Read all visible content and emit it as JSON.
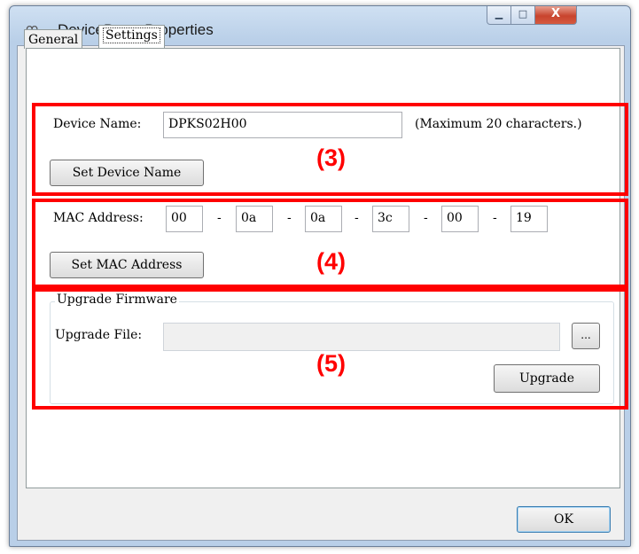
{
  "window": {
    "title": "DevicePort - Properties",
    "app_icon": "ꝏ"
  },
  "controls": {
    "minimize": "▁",
    "maximize": "□",
    "close": "X"
  },
  "tabs": [
    {
      "label": "General"
    },
    {
      "label": "Settings"
    }
  ],
  "device_name": {
    "label": "Device Name:",
    "value": "DPKS02H00",
    "hint": "(Maximum  20 characters.)",
    "button": "Set Device Name"
  },
  "mac": {
    "label": "MAC Address:",
    "octets": [
      "00",
      "0a",
      "0a",
      "3c",
      "00",
      "19"
    ],
    "separator": "-",
    "button": "Set MAC Address"
  },
  "firmware": {
    "group_label": "Upgrade Firmware",
    "file_label": "Upgrade File:",
    "file_value": "",
    "browse_label": "...",
    "upgrade_button": "Upgrade"
  },
  "footer": {
    "ok_label": "OK"
  },
  "annotations": [
    "(3)",
    "(4)",
    "(5)"
  ],
  "colors": {
    "annotation": "#ff0000"
  }
}
